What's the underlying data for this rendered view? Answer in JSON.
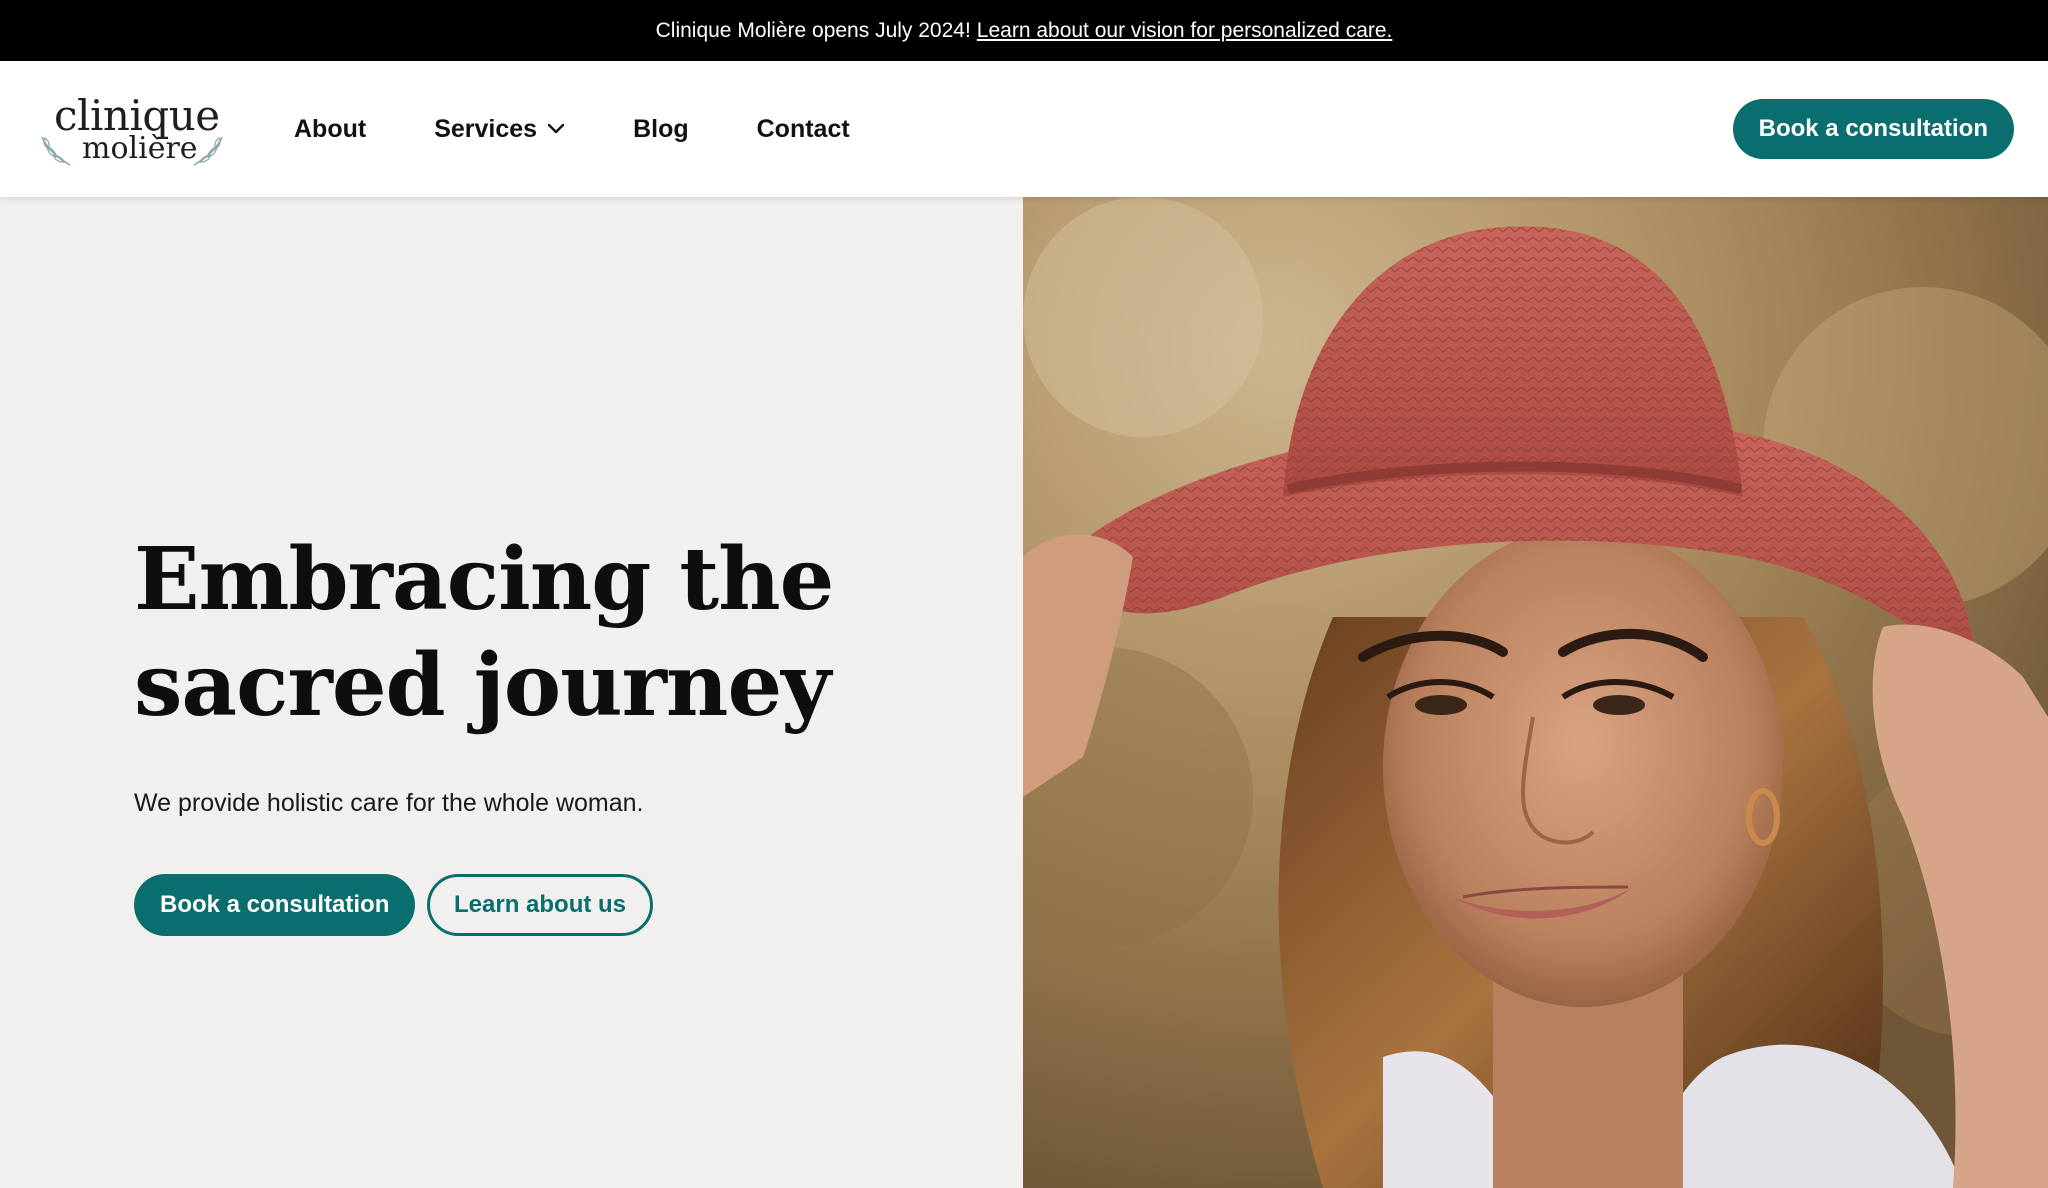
{
  "announcement": {
    "text": "Clinique Molière opens July 2024!",
    "link_text": "Learn about our vision for personalized care."
  },
  "logo": {
    "line1": "clinique",
    "line2": "molière"
  },
  "nav": {
    "items": [
      {
        "label": "About"
      },
      {
        "label": "Services"
      },
      {
        "label": "Blog"
      },
      {
        "label": "Contact"
      }
    ],
    "cta_label": "Book a consultation"
  },
  "hero": {
    "title_line1": "Embracing the",
    "title_line2": "sacred journey",
    "subtitle": "We provide holistic care for the whole woman.",
    "primary_button": "Book a consultation",
    "secondary_button": "Learn about us"
  },
  "colors": {
    "brand": "#0b6e6e",
    "hero_bg": "#f2f0ef",
    "announce_bg": "#000000"
  }
}
